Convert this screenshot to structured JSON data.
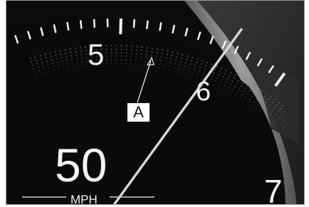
{
  "gauge": {
    "scale_labels": {
      "five": "5",
      "six": "6",
      "seven": "7"
    },
    "speed_value": "50",
    "speed_unit": "MPH",
    "callout_label": "A"
  },
  "colors": {
    "background": "#0b0b0b",
    "tick": "#f2f2f2",
    "text": "#f4f4f4",
    "needle": "#d8d8d8",
    "bezel": "#8a8a8a"
  }
}
